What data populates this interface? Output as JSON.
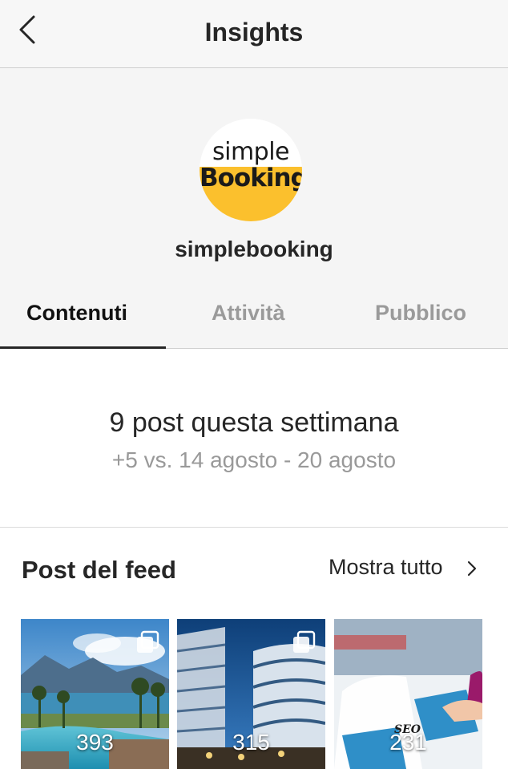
{
  "header": {
    "title": "Insights",
    "back_icon": "chevron-left-icon"
  },
  "profile": {
    "username": "simplebooking",
    "avatar_text_top": "simple",
    "avatar_text_bottom": "Booking",
    "brand_color": "#fbc02d"
  },
  "tabs": [
    {
      "label": "Contenuti",
      "active": true
    },
    {
      "label": "Attività",
      "active": false
    },
    {
      "label": "Pubblico",
      "active": false
    }
  ],
  "summary": {
    "title": "9 post questa settimana",
    "subtitle": "+5 vs. 14 agosto - 20 agosto"
  },
  "feed": {
    "title": "Post del feed",
    "show_all_label": "Mostra tutto",
    "posts": [
      {
        "count": "393",
        "multi": true,
        "scene": "lake-resort"
      },
      {
        "count": "315",
        "multi": true,
        "scene": "modern-building"
      },
      {
        "count": "231",
        "multi": false,
        "scene": "laptop-seo",
        "overlay_text": "SEO"
      }
    ]
  }
}
